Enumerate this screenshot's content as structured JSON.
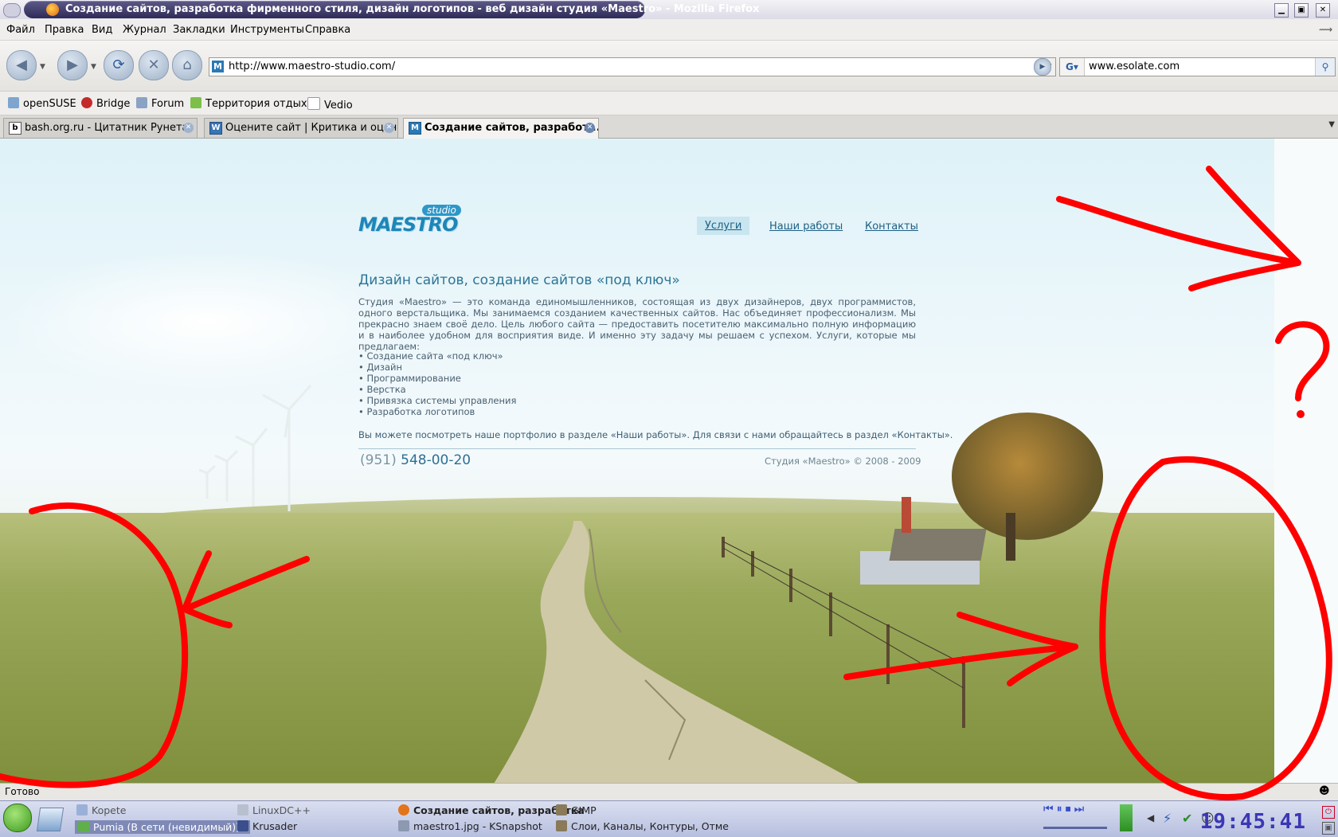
{
  "window": {
    "title": "Создание сайтов, разработка фирменного стиля, дизайн логотипов - веб дизайн студия «Maestro» - Mozilla Firefox"
  },
  "menu": [
    "Файл",
    "Правка",
    "Вид",
    "Журнал",
    "Закладки",
    "Инструменты",
    "Справка"
  ],
  "nav": {
    "url": "http://www.maestro-studio.com/",
    "search_value": "www.esolate.com",
    "search_engine_label": "G"
  },
  "bookmarks": [
    "openSUSE",
    "Bridge",
    "Forum",
    "Территория отдыха",
    "Vedio"
  ],
  "tabs": [
    {
      "label": "bash.org.ru - Цитатник Рунета",
      "favicon": "b"
    },
    {
      "label": "Оцените сайт | Критика и оцен...",
      "favicon": "W"
    },
    {
      "label": "Создание сайтов, разработ...",
      "favicon": "M"
    }
  ],
  "site": {
    "logo_word": "MAESTRO",
    "logo_badge": "studio",
    "nav": [
      "Услуги",
      "Наши работы",
      "Контакты"
    ],
    "heading": "Дизайн сайтов, создание сайтов «под ключ»",
    "intro": "Студия «Maestro» — это команда единомышленников, состоящая из двух дизайнеров, двух программистов, одного верстальщика. Мы занимаемся созданием качественных сайтов. Нас объединяет профессионализм. Мы прекрасно знаем своё дело. Цель любого сайта — предоставить посетителю максимально полную информацию и в наиболее удобном для восприятия виде. И именно эту задачу мы решаем с успехом. Услуги, которые мы предлагаем:",
    "services": [
      "• Создание сайта «под ключ»",
      "• Дизайн",
      "• Программирование",
      "• Верстка",
      "• Привязка системы управления",
      "• Разработка логотипов"
    ],
    "outro": "Вы можете посмотреть наше портфолио в разделе «Наши работы». Для связи с нами обращайтесь в раздел «Контакты».",
    "phone_code": "(951)",
    "phone_number": "548-00-20",
    "copyright": "Студия «Maestro» © 2008 - 2009"
  },
  "annotation": {
    "question_mark": "?",
    "color": "#ff0000"
  },
  "status": "Готово",
  "taskbar": {
    "col1": [
      "Kopete",
      "Pumia (В сети (невидимый)) -"
    ],
    "col2": [
      "LinuxDC++",
      "Krusader"
    ],
    "col3": [
      "Создание сайтов, разработка",
      "maestro1.jpg - KSnapshot"
    ],
    "col4": [
      "GIMP",
      "Слои, Каналы, Контуры, Отме"
    ],
    "clock": "19:45:41"
  }
}
